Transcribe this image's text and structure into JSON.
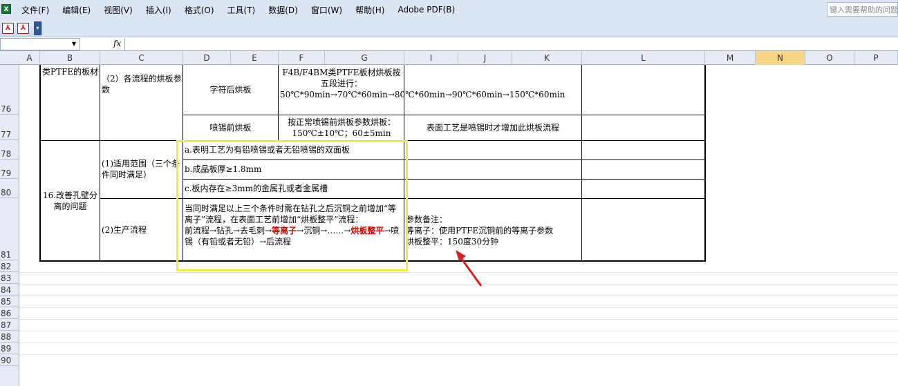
{
  "menubar": {
    "app_icon": "excel-icon",
    "items": [
      "文件(F)",
      "编辑(E)",
      "视图(V)",
      "插入(I)",
      "格式(O)",
      "工具(T)",
      "数据(D)",
      "窗口(W)",
      "帮助(H)",
      "Adobe PDF(B)"
    ],
    "help_placeholder": "键入需要帮助的问题"
  },
  "toolbar": {
    "pdf1_glyph": "⅄",
    "pdf2_glyph": "⅄",
    "handle_glyph": "▾"
  },
  "formula_bar": {
    "name_box": "",
    "fx": "fx",
    "dropdown_glyph": "▼"
  },
  "columns": [
    "A",
    "B",
    "C",
    "D",
    "E",
    "F",
    "G",
    "I",
    "J",
    "K",
    "L",
    "M",
    "N",
    "O",
    "P"
  ],
  "active_column": "N",
  "rows": [
    "76",
    "77",
    "78",
    "79",
    "80",
    "81",
    "82",
    "83",
    "84",
    "85",
    "86",
    "87",
    "88",
    "89",
    "90"
  ],
  "cells": {
    "b76": "类PTFE的板材",
    "c76": "（2）各流程的烘板参数",
    "d76": "字符后烘板",
    "f76": "F4B/F4BM类PTFE板材烘板按五段进行：50℃*90min→70℃*60min→80℃*60min→90℃*60min→150℃*60min",
    "d77": "喷锡前烘板",
    "f77": "按正常喷锡前烘板参数烘板：150℃±10℃；60±5min",
    "i77": "表面工艺是喷锡时才增加此烘板流程",
    "b78": "16.改善孔壁分离的问题",
    "c78": "(1)适用范围（三个条件同时满足）",
    "d78": "a.表明工艺为有铅喷锡或者无铅喷锡的双面板",
    "d79": "b.成品板厚≥1.8mm",
    "d80": "c.板内存在≥3mm的金属孔或者金属槽",
    "c81": "(2)生产流程",
    "d81_line1": "当同时满足以上三个条件时需在钻孔之后沉铜之前增加“等离子”流程，在表面工艺前增加“烘板整平”流程：",
    "d81_flow_a": "前流程→钻孔→去毛刺→",
    "d81_flow_b": "等离子",
    "d81_flow_c": "→沉铜→……→",
    "d81_flow_d": "烘板整平",
    "d81_flow_e": "→喷锡（有铅或者无铅）→后流程",
    "i81_line1": "参数备注：",
    "i81_line2": "等离子：使用PTFE沉铜前的等离子参数",
    "i81_line3": "烘板整平：150度30分钟"
  },
  "annotation": {
    "highlight_color": "#f2ec3b",
    "arrow_color": "#d62020"
  }
}
